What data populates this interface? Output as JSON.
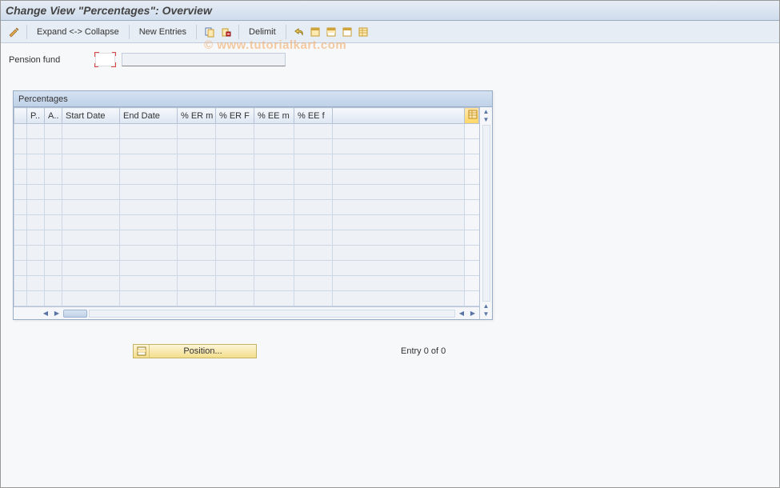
{
  "title": "Change View \"Percentages\": Overview",
  "toolbar": {
    "expand_collapse": "Expand <-> Collapse",
    "new_entries": "New Entries",
    "delimit": "Delimit"
  },
  "watermark": "© www.tutorialkart.com",
  "fields": {
    "pension_fund_label": "Pension fund"
  },
  "grid": {
    "panel_title": "Percentages",
    "columns": [
      "P..",
      "A..",
      "Start Date",
      "End Date",
      "% ER m",
      "% ER F",
      "% EE m",
      "% EE f"
    ],
    "row_count": 12
  },
  "footer": {
    "position_label": "Position...",
    "entry_text": "Entry 0 of 0"
  },
  "icons": {
    "toggle": "toggle-icon",
    "copy": "copy-icon",
    "delete": "delete-icon",
    "undo": "undo-icon",
    "select_all": "select-all-icon",
    "deselect_all": "deselect-all-icon",
    "print": "print-icon",
    "config": "config-layout-icon",
    "position": "position-icon"
  }
}
